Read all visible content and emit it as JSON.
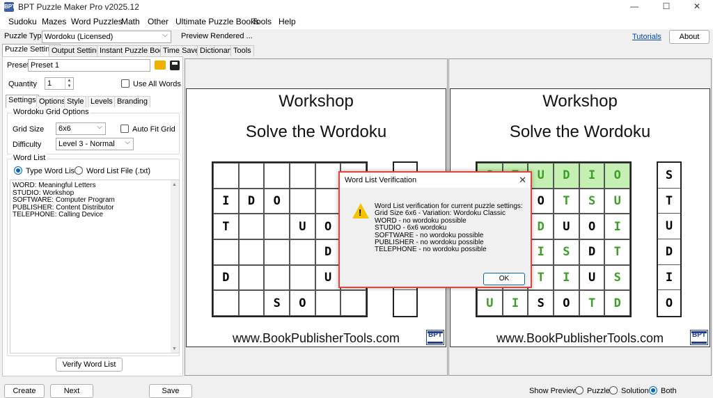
{
  "window": {
    "title": "BPT Puzzle Maker Pro v2025.12",
    "app_icon": "BPT",
    "minimize": "—",
    "maximize": "☐",
    "close": "✕"
  },
  "menu": [
    "Sudoku",
    "Mazes",
    "Word Puzzles",
    "Math",
    "Other",
    "Ultimate Puzzle Books",
    "Tools",
    "Help"
  ],
  "puzzle_type": {
    "label": "Puzzle Type",
    "value": "Wordoku (Licensed)",
    "status": "Preview Rendered ...",
    "tutorials": "Tutorials",
    "about": "About"
  },
  "tabs": [
    "Puzzle Settings",
    "Output Settings",
    "Instant Puzzle Books",
    "Time Saver",
    "Dictionary",
    "Tools"
  ],
  "settings": {
    "preset_label": "Preset",
    "preset_value": "Preset 1",
    "quantity_label": "Quantity",
    "quantity_value": "1",
    "use_all_words": "Use All Words",
    "subtabs": [
      "Settings",
      "Options",
      "Style",
      "Levels",
      "Branding"
    ],
    "grid_group": "Wordoku Grid Options",
    "grid_size_label": "Grid Size",
    "grid_size_value": "6x6",
    "auto_fit": "Auto Fit Grid",
    "difficulty_label": "Difficulty",
    "difficulty_value": "Level 3 - Normal",
    "word_list_group": "Word List",
    "type_word_list": "Type Word List",
    "word_list_file": "Word List File (.txt)",
    "word_lines": [
      "WORD: Meaningful Letters",
      "STUDIO: Workshop",
      "SOFTWARE: Computer Program",
      "PUBLISHER: Content Distributor",
      "TELEPHONE: Calling Device"
    ],
    "verify_button": "Verify Word List"
  },
  "puzzle_page": {
    "title": "Workshop",
    "subtitle": "Solve the Wordoku",
    "url": "www.BookPublisherTools.com",
    "logo": "BPT",
    "grid": [
      [
        "",
        "",
        "",
        "",
        "",
        ""
      ],
      [
        "I",
        "D",
        "O",
        "",
        "",
        ""
      ],
      [
        "T",
        "",
        "",
        "U",
        "O",
        ""
      ],
      [
        "",
        "",
        "",
        "",
        "D",
        ""
      ],
      [
        "D",
        "",
        "",
        "",
        "U",
        ""
      ],
      [
        "",
        "",
        "S",
        "O",
        "",
        ""
      ]
    ],
    "word_column": [
      "",
      "",
      "",
      "",
      "",
      ""
    ]
  },
  "solution_page": {
    "title": "Workshop",
    "subtitle": "Solve the Wordoku",
    "url": "www.BookPublisherTools.com",
    "logo": "BPT",
    "grid": [
      [
        "S",
        "T",
        "U",
        "D",
        "I",
        "O"
      ],
      [
        "",
        "",
        "O",
        "T",
        "S",
        "U"
      ],
      [
        "",
        "",
        "D",
        "U",
        "O",
        "I"
      ],
      [
        "",
        "",
        "I",
        "S",
        "D",
        "T"
      ],
      [
        "",
        "",
        "T",
        "I",
        "U",
        "S"
      ],
      [
        "U",
        "I",
        "S",
        "O",
        "T",
        "D"
      ]
    ],
    "word_column": [
      "S",
      "T",
      "U",
      "D",
      "I",
      "O"
    ]
  },
  "dialog": {
    "title": "Word List Verification",
    "close": "✕",
    "lines": [
      "Word List verification for current puzzle settings:",
      "Grid Size 6x6 -  Variation: Wordoku Classic",
      "WORD - no wordoku possible",
      "STUDIO - 6x6 wordoku",
      "SOFTWARE - no wordoku possible",
      "PUBLISHER - no wordoku possible",
      "TELEPHONE - no wordoku possible"
    ],
    "ok": "OK"
  },
  "bottom": {
    "create": "Create",
    "next_preview": "Next Preview",
    "save_preview": "Save Preview",
    "show_preview": "Show Preview:",
    "opt_puzzle": "Puzzle",
    "opt_solution": "Solution",
    "opt_both": "Both"
  },
  "colors": {
    "accent": "#0067c0",
    "dialog_border": "#e0453a",
    "green_letter": "#3a9f24",
    "green_shade": "#c6efb4"
  }
}
